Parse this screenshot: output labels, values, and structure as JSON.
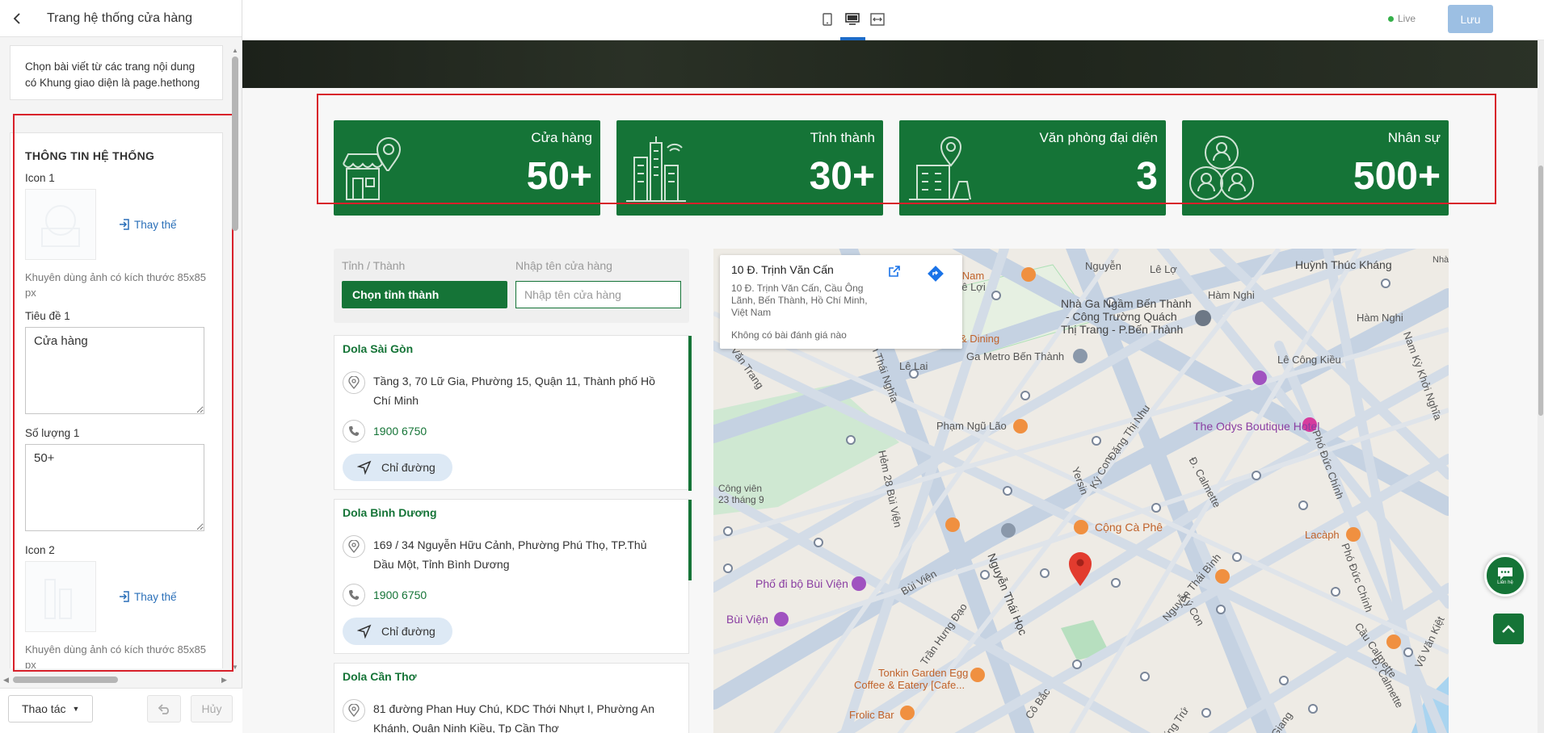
{
  "panel": {
    "title": "Trang hệ thống cửa hàng",
    "note": "Chọn bài viết từ các trang nội dung có Khung giao diện là page.hethong",
    "section_title": "THÔNG TIN HỆ THỐNG",
    "icon1_label": "Icon 1",
    "replace_label": "Thay thế",
    "hint": "Khuyên dùng ảnh có kích thước 85x85 px",
    "title1_label": "Tiêu đề 1",
    "title1_value": "Cửa hàng",
    "count1_label": "Số lượng 1",
    "count1_value": "50+",
    "icon2_label": "Icon 2",
    "actions_label": "Thao tác",
    "cancel_label": "Hủy"
  },
  "topbar": {
    "live_label": "Live",
    "save_label": "Lưu"
  },
  "stats": [
    {
      "label": "Cửa hàng",
      "value": "50+",
      "icon": "store-icon"
    },
    {
      "label": "Tỉnh thành",
      "value": "30+",
      "icon": "city-icon"
    },
    {
      "label": "Văn phòng đại diện",
      "value": "3",
      "icon": "office-icon"
    },
    {
      "label": "Nhân sự",
      "value": "500+",
      "icon": "people-icon"
    }
  ],
  "filter": {
    "province_label": "Tỉnh / Thành",
    "province_button": "Chọn tỉnh thành",
    "name_label": "Nhập tên cửa hàng",
    "name_placeholder": "Nhập tên cửa hàng"
  },
  "stores": [
    {
      "name": "Dola Sài Gòn",
      "address": "Tầng 3, 70 Lữ Gia, Phường 15, Quận 11, Thành phố Hồ Chí Minh",
      "phone": "1900 6750",
      "directions": "Chỉ đường"
    },
    {
      "name": "Dola Bình Dương",
      "address": "169 / 34 Nguyễn Hữu Cảnh, Phường Phú Thọ, TP.Thủ Dầu Một, Tỉnh Bình Dương",
      "phone": "1900 6750",
      "directions": "Chỉ đường"
    },
    {
      "name": "Dola Cần Thơ",
      "address": "81 đường Phan Huy Chú, KDC Thới Nhựt I, Phường An Khánh, Quận Ninh Kiều, Tp Cần Thơ"
    }
  ],
  "map": {
    "card_title": "10 Đ. Trịnh Văn Cấn",
    "card_address": "10 Đ. Trịnh Văn Cấn, Cầu Ông Lãnh, Bến Thành, Hồ Chí Minh, Việt Nam",
    "card_reviews": "Không có bài đánh giá nào",
    "labels": {
      "l1": "Lê Lợi",
      "l2": "Nguyễn",
      "l3": "Lê Lợ",
      "l4": "Huỳnh Thúc Kháng",
      "l5": "Nhà",
      "l6": "Việt Nam",
      "l7": "Nhà Ga Ngầm Bến Thành",
      "l8": "- Công Trường Quách",
      "l9": "Thị Trang - P.Bến Thành",
      "l10": "Hàm Nghi",
      "l11": "Hàm Nghi",
      "l12": "& Dining",
      "l13": "Ga Metro Bến Thành",
      "l14": "Lê Công Kiều",
      "l15": "Lê Lai",
      "l16": "Phạm Ngũ Lão",
      "l17": "The Odys Boutique Hotel",
      "l18": "Công viên",
      "l19": "23 tháng 9",
      "l20": "Cộng Cà Phê",
      "l21": "Lacàph",
      "l22": "Phố đi bộ Bùi Viện",
      "l23": "Bùi Viện",
      "l24": "Tonkin Garden Egg",
      "l25": "Coffee & Eatery [Cafe...",
      "l26": "Frolic Bar",
      "l27": "Nguyễn Thái Bình",
      "l28": "Ký Con",
      "l29": "Đặng Thị Nhu",
      "l30": "Yersin",
      "l31": "Bùi Viện",
      "l32": "Trần Hưng Đạo",
      "l33": "Nguyễn Thái Học",
      "l34": "Cô Bắc",
      "l35": "Cô Giang",
      "l36": "Cầu Calmette",
      "l37": "Phó Đức Chính",
      "l38": "Đ. Calmette",
      "l39": "Võ Văn Kiệt",
      "l40": "Nam Kỳ Khởi Nghĩa",
      "l41": "Hẻm 28 Bùi Viện",
      "l42": "Ký Con",
      "l43": "Nguyễn Thái Nghĩa",
      "l44": "Cống Trứ",
      "l45": "Phó Đức Chính",
      "l46": "Đ. Calmette",
      "l47": "Văn Trang"
    }
  },
  "chat_label": "Liên hệ",
  "colors": {
    "brand_green": "#157437",
    "highlight_red": "#d8202a",
    "save_blue": "#9cbfe3"
  }
}
